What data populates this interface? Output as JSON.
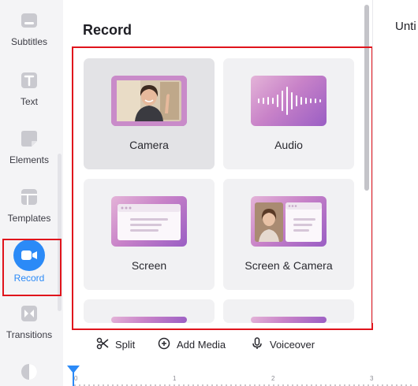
{
  "sidebar": {
    "items": [
      {
        "label": "Subtitles",
        "icon": "subtitles-icon"
      },
      {
        "label": "Text",
        "icon": "text-icon"
      },
      {
        "label": "Elements",
        "icon": "elements-icon"
      },
      {
        "label": "Templates",
        "icon": "templates-icon"
      },
      {
        "label": "Record",
        "icon": "record-camera-icon",
        "active": true
      },
      {
        "label": "Transitions",
        "icon": "transitions-icon"
      },
      {
        "label": "",
        "icon": "filters-icon"
      }
    ]
  },
  "panel": {
    "title": "Record",
    "cards": [
      {
        "label": "Camera",
        "selected": true
      },
      {
        "label": "Audio"
      },
      {
        "label": "Screen"
      },
      {
        "label": "Screen & Camera"
      }
    ]
  },
  "right": {
    "title": "Unti"
  },
  "toolbar": {
    "split_label": "Split",
    "add_media_label": "Add Media",
    "voiceover_label": "Voiceover"
  },
  "timeline": {
    "ticks": [
      "0",
      "1",
      "2",
      "3"
    ]
  },
  "colors": {
    "accent": "#2b8af7",
    "highlight": "#e0141c",
    "thumb_gradient": [
      "#e4b4d8",
      "#c882c8",
      "#9a5ec4"
    ]
  }
}
